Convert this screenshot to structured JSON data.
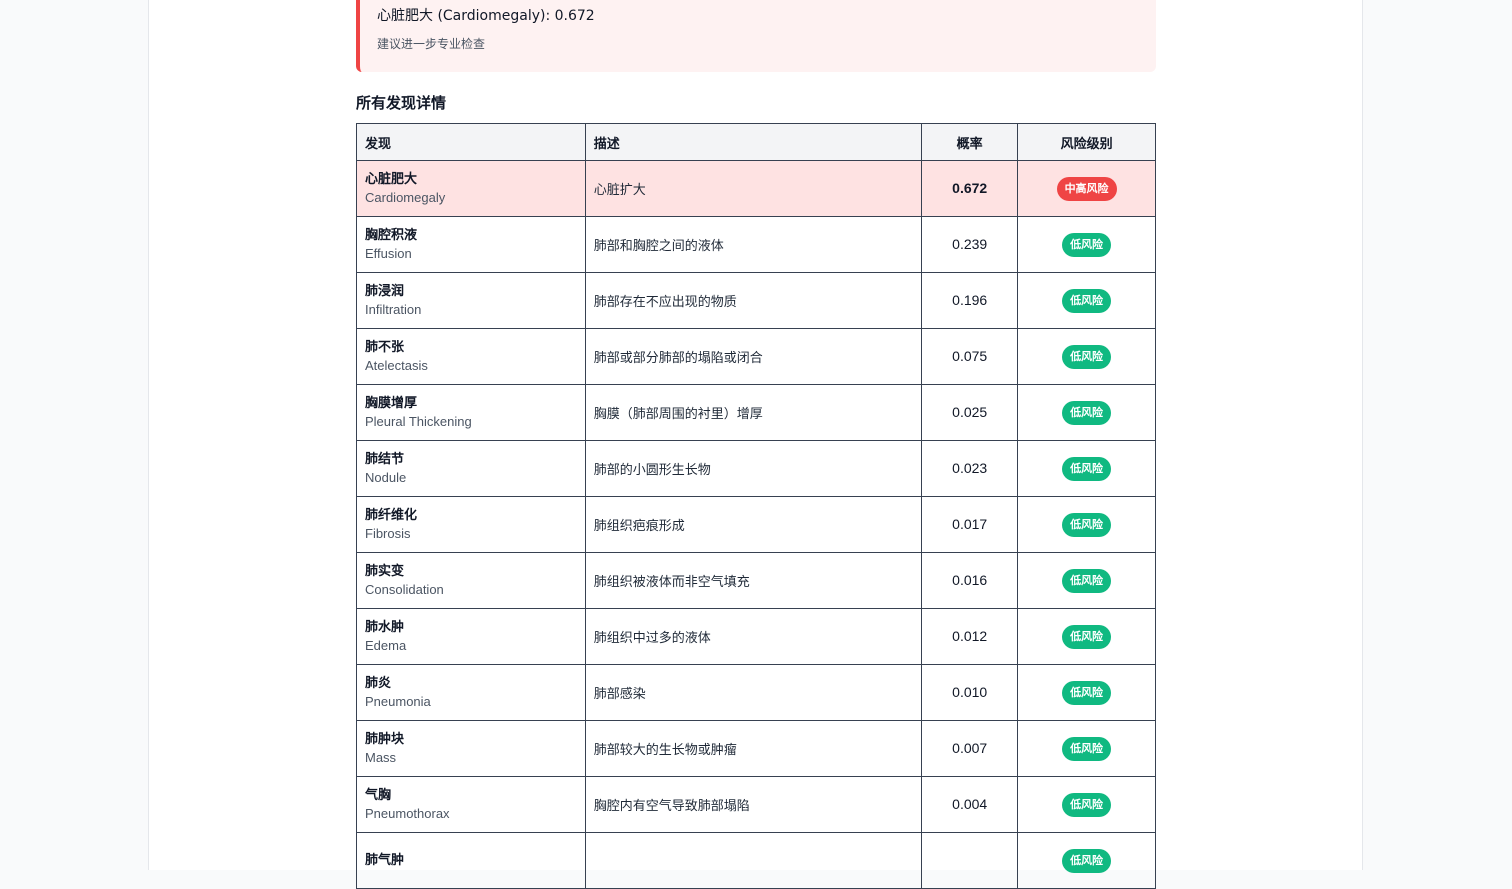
{
  "alert": {
    "title": "心脏肥大 (Cardiomegaly): 0.672",
    "subtitle": "建议进一步专业检查"
  },
  "section_title": "所有发现详情",
  "table": {
    "headers": [
      "发现",
      "描述",
      "概率",
      "风险级别"
    ],
    "rows": [
      {
        "zh": "心脏肥大",
        "en": "Cardiomegaly",
        "desc": "心脏扩大",
        "prob": "0.672",
        "risk": "中高风险",
        "level": "high"
      },
      {
        "zh": "胸腔积液",
        "en": "Effusion",
        "desc": "肺部和胸腔之间的液体",
        "prob": "0.239",
        "risk": "低风险",
        "level": "low"
      },
      {
        "zh": "肺浸润",
        "en": "Infiltration",
        "desc": "肺部存在不应出现的物质",
        "prob": "0.196",
        "risk": "低风险",
        "level": "low"
      },
      {
        "zh": "肺不张",
        "en": "Atelectasis",
        "desc": "肺部或部分肺部的塌陷或闭合",
        "prob": "0.075",
        "risk": "低风险",
        "level": "low"
      },
      {
        "zh": "胸膜增厚",
        "en": "Pleural Thickening",
        "desc": "胸膜（肺部周围的衬里）增厚",
        "prob": "0.025",
        "risk": "低风险",
        "level": "low"
      },
      {
        "zh": "肺结节",
        "en": "Nodule",
        "desc": "肺部的小圆形生长物",
        "prob": "0.023",
        "risk": "低风险",
        "level": "low"
      },
      {
        "zh": "肺纤维化",
        "en": "Fibrosis",
        "desc": "肺组织疤痕形成",
        "prob": "0.017",
        "risk": "低风险",
        "level": "low"
      },
      {
        "zh": "肺实变",
        "en": "Consolidation",
        "desc": "肺组织被液体而非空气填充",
        "prob": "0.016",
        "risk": "低风险",
        "level": "low"
      },
      {
        "zh": "肺水肿",
        "en": "Edema",
        "desc": "肺组织中过多的液体",
        "prob": "0.012",
        "risk": "低风险",
        "level": "low"
      },
      {
        "zh": "肺炎",
        "en": "Pneumonia",
        "desc": "肺部感染",
        "prob": "0.010",
        "risk": "低风险",
        "level": "low"
      },
      {
        "zh": "肺肿块",
        "en": "Mass",
        "desc": "肺部较大的生长物或肿瘤",
        "prob": "0.007",
        "risk": "低风险",
        "level": "low"
      },
      {
        "zh": "气胸",
        "en": "Pneumothorax",
        "desc": "胸腔内有空气导致肺部塌陷",
        "prob": "0.004",
        "risk": "低风险",
        "level": "low"
      },
      {
        "zh": "肺气肿",
        "en": "",
        "desc": "",
        "prob": "",
        "risk": "低风险",
        "level": "low"
      }
    ]
  },
  "colors": {
    "high_risk": "#ef4444",
    "low_risk": "#10b981",
    "highlight_row": "#fee2e2",
    "alert_bg": "#fef2f2"
  }
}
